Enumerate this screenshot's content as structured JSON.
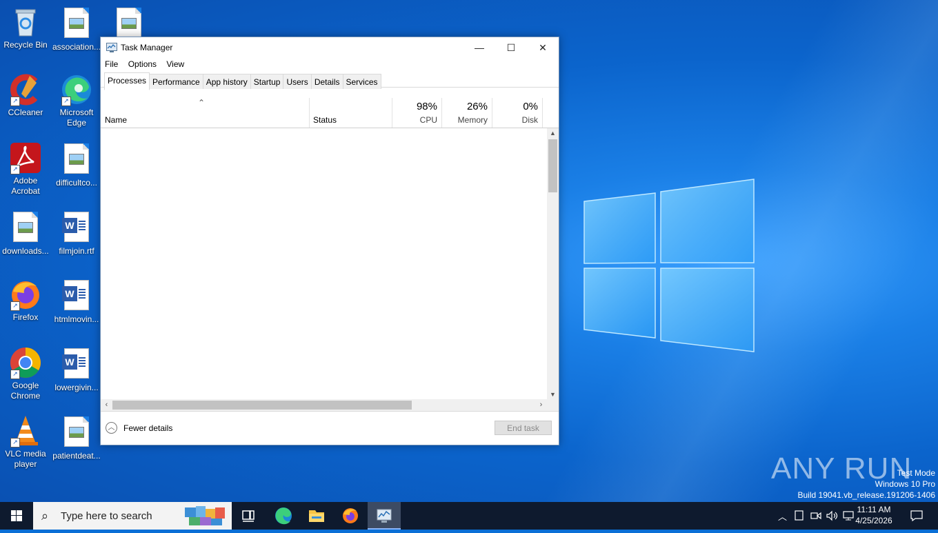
{
  "desktop": {
    "icons": [
      {
        "label": "Recycle Bin"
      },
      {
        "label": "association..."
      },
      {
        "label": ""
      },
      {
        "label": "CCleaner"
      },
      {
        "label": "Microsoft Edge"
      },
      {
        "label": "Adobe Acrobat"
      },
      {
        "label": "difficultco..."
      },
      {
        "label": "downloads..."
      },
      {
        "label": "filmjoin.rtf"
      },
      {
        "label": "Firefox"
      },
      {
        "label": "htmlmovin..."
      },
      {
        "label": "Google Chrome"
      },
      {
        "label": "lowergivin..."
      },
      {
        "label": "VLC media player"
      },
      {
        "label": "patientdeat..."
      }
    ]
  },
  "window": {
    "title": "Task Manager",
    "minimize_label": "—",
    "maximize_label": "☐",
    "close_label": "✕",
    "menu": [
      "File",
      "Options",
      "View"
    ],
    "tabs": [
      "Processes",
      "Performance",
      "App history",
      "Startup",
      "Users",
      "Details",
      "Services"
    ],
    "columns": {
      "name": "Name",
      "status": "Status",
      "cpu_pct": "98%",
      "cpu": "CPU",
      "memory_pct": "26%",
      "memory": "Memory",
      "disk_pct": "0%",
      "disk": "Disk"
    },
    "footer": {
      "fewer_details": "Fewer details",
      "end_task": "End task"
    }
  },
  "watermark": {
    "brand": "ANY RUN",
    "line1": "Test Mode",
    "line2": "Windows 10 Pro",
    "line3": "Build 19041.vb_release.191206-1406"
  },
  "taskbar": {
    "search_placeholder": "Type here to search",
    "time": "11:11 AM",
    "date": "4/25/2026"
  }
}
